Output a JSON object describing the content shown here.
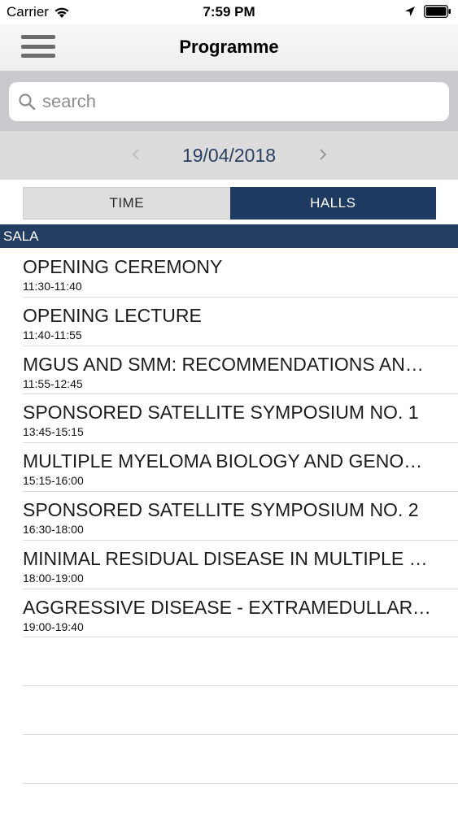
{
  "status_bar": {
    "carrier": "Carrier",
    "time": "7:59 PM"
  },
  "navbar": {
    "title": "Programme",
    "menu_icon": "hamburger-menu-icon"
  },
  "search": {
    "placeholder": "search",
    "value": ""
  },
  "date_nav": {
    "date": "19/04/2018"
  },
  "segments": {
    "time_label": "TIME",
    "halls_label": "HALLS",
    "selected": "HALLS"
  },
  "section": {
    "title": "SALA"
  },
  "sessions": [
    {
      "title": "OPENING CEREMONY",
      "time": "11:30-11:40"
    },
    {
      "title": "OPENING LECTURE",
      "time": "11:40-11:55"
    },
    {
      "title": "MGUS AND SMM: RECOMMENDATIONS AND…",
      "time": "11:55-12:45"
    },
    {
      "title": "SPONSORED SATELLITE SYMPOSIUM NO. 1",
      "time": "13:45-15:15"
    },
    {
      "title": "MULTIPLE MYELOMA BIOLOGY AND GENOM…",
      "time": "15:15-16:00"
    },
    {
      "title": "SPONSORED SATELLITE SYMPOSIUM NO. 2",
      "time": "16:30-18:00"
    },
    {
      "title": "MINIMAL RESIDUAL DISEASE IN MULTIPLE M…",
      "time": "18:00-19:00"
    },
    {
      "title": "AGGRESSIVE DISEASE - EXTRAMEDULLARY D…",
      "time": "19:00-19:40"
    }
  ],
  "colors": {
    "accent": "#1f3a60",
    "section_header": "#233d63",
    "date_text": "#2a3e5e"
  }
}
